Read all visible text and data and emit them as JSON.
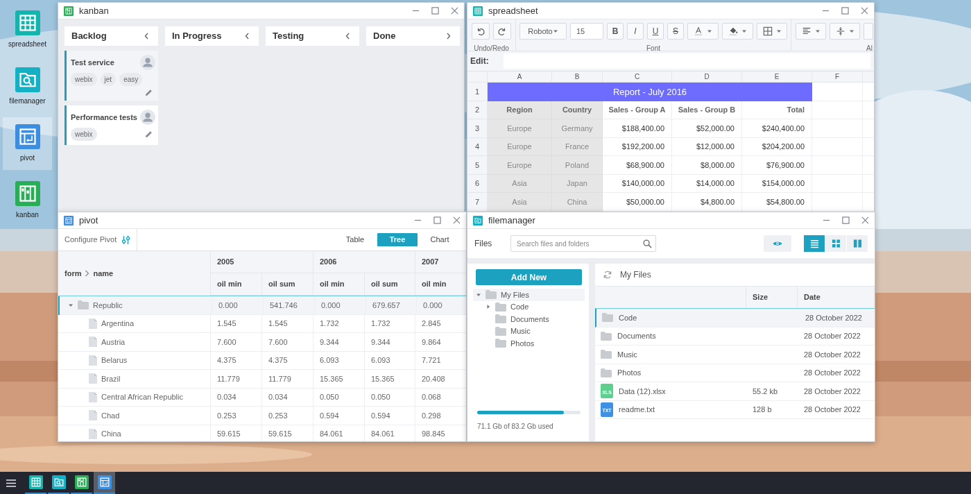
{
  "desktop_icons": [
    {
      "kind": "spreadsheet",
      "label": "spreadsheet",
      "selected": false
    },
    {
      "kind": "filemanager",
      "label": "filemanager",
      "selected": false
    },
    {
      "kind": "pivot",
      "label": "pivot",
      "selected": true
    },
    {
      "kind": "kanban",
      "label": "kanban",
      "selected": false
    }
  ],
  "kanban": {
    "title": "kanban",
    "columns": [
      {
        "title": "Backlog",
        "points_right": false,
        "cards": [
          {
            "title": "Test service",
            "tags": [
              "webix",
              "jet",
              "easy"
            ],
            "selected": true
          },
          {
            "title": "Performance tests",
            "tags": [
              "webix"
            ],
            "selected": false
          }
        ]
      },
      {
        "title": "In Progress",
        "points_right": false
      },
      {
        "title": "Testing",
        "points_right": false
      },
      {
        "title": "Done",
        "points_right": true
      }
    ]
  },
  "spreadsheet": {
    "title": "spreadsheet",
    "toolbar": {
      "font": "Roboto",
      "size": "15",
      "style_buttons": [
        "B",
        "I",
        "U",
        "S"
      ],
      "groups": [
        "Undo/Redo",
        "Font",
        "Al"
      ]
    },
    "edit_label": "Edit:",
    "columns": [
      "A",
      "B",
      "C",
      "D",
      "E",
      "F"
    ],
    "row_numbers": [
      "1",
      "2",
      "3",
      "4",
      "5",
      "6",
      "7"
    ],
    "title_cell": "Report - July 2016",
    "header": [
      "Region",
      "Country",
      "Sales - Group A",
      "Sales - Group B",
      "Total"
    ],
    "rows": [
      [
        "Europe",
        "Germany",
        "$188,400.00",
        "$52,000.00",
        "$240,400.00"
      ],
      [
        "Europe",
        "France",
        "$192,200.00",
        "$12,000.00",
        "$204,200.00"
      ],
      [
        "Europe",
        "Poland",
        "$68,900.00",
        "$8,000.00",
        "$76,900.00"
      ],
      [
        "Asia",
        "Japan",
        "$140,000.00",
        "$14,000.00",
        "$154,000.00"
      ],
      [
        "Asia",
        "China",
        "$50,000.00",
        "$4,800.00",
        "$54,800.00"
      ]
    ]
  },
  "pivot": {
    "title": "pivot",
    "configure": "Configure Pivot",
    "modes": [
      {
        "label": "Table",
        "selected": false
      },
      {
        "label": "Tree",
        "selected": true
      },
      {
        "label": "Chart",
        "selected": false
      }
    ],
    "row_header": [
      "form",
      "name"
    ],
    "years": [
      "2005",
      "2006",
      "2007"
    ],
    "measures": [
      "oil min",
      "oil sum",
      "oil min",
      "oil sum",
      "oil min"
    ],
    "rows": [
      {
        "name": "Republic",
        "expanded": true,
        "selected": true,
        "values": [
          "0.000",
          "541.746",
          "0.000",
          "679.657",
          "0.000"
        ],
        "children": [
          {
            "name": "Argentina",
            "selected": false,
            "values": [
              "1.545",
              "1.545",
              "1.732",
              "1.732",
              "2.845"
            ]
          },
          {
            "name": "Austria",
            "selected": false,
            "values": [
              "7.600",
              "7.600",
              "9.344",
              "9.344",
              "9.864"
            ]
          },
          {
            "name": "Belarus",
            "selected": false,
            "values": [
              "4.375",
              "4.375",
              "6.093",
              "6.093",
              "7.721"
            ]
          },
          {
            "name": "Brazil",
            "selected": false,
            "values": [
              "11.779",
              "11.779",
              "15.365",
              "15.365",
              "20.408"
            ]
          },
          {
            "name": "Central African Republic",
            "selected": false,
            "values": [
              "0.034",
              "0.034",
              "0.050",
              "0.050",
              "0.068"
            ]
          },
          {
            "name": "Chad",
            "selected": false,
            "values": [
              "0.253",
              "0.253",
              "0.594",
              "0.594",
              "0.298"
            ]
          },
          {
            "name": "China",
            "selected": false,
            "values": [
              "59.615",
              "59.615",
              "84.061",
              "84.061",
              "98.845"
            ]
          }
        ]
      }
    ]
  },
  "filemanager": {
    "title": "filemanager",
    "label": "Files",
    "search": {
      "placeholder": "Search files and folders"
    },
    "views": [
      {
        "kind": "list",
        "selected": true
      },
      {
        "kind": "grid",
        "selected": false
      },
      {
        "kind": "columns",
        "selected": false
      }
    ],
    "add_button": "Add New",
    "tree": [
      {
        "name": "My Files",
        "expanded": true,
        "selected": true,
        "children": [
          {
            "name": "Code",
            "has_children": true,
            "selected": false
          },
          {
            "name": "Documents",
            "has_children": false,
            "selected": false
          },
          {
            "name": "Music",
            "has_children": false,
            "selected": false
          },
          {
            "name": "Photos",
            "has_children": false,
            "selected": false
          }
        ]
      }
    ],
    "storage": {
      "level": 0.84,
      "text": "71.1 Gb of 83.2 Gb used"
    },
    "path": "My Files",
    "columns": [
      "Size",
      "Date"
    ],
    "files": [
      {
        "kind": "folder",
        "name": "Code",
        "date": "28 October 2022",
        "selected": true
      },
      {
        "kind": "folder",
        "name": "Documents",
        "date": "28 October 2022",
        "selected": false
      },
      {
        "kind": "folder",
        "name": "Music",
        "date": "28 October 2022",
        "selected": false
      },
      {
        "kind": "folder",
        "name": "Photos",
        "date": "28 October 2022",
        "selected": false
      },
      {
        "kind": "xls",
        "badge": "XLS",
        "name": "Data (12).xlsx",
        "size": "55.2 kb",
        "date": "28 October 2022",
        "selected": false
      },
      {
        "kind": "txt",
        "badge": "TXT",
        "name": "readme.txt",
        "size": "128 b",
        "date": "28 October 2022",
        "selected": false
      }
    ]
  },
  "taskbar": {
    "apps": [
      {
        "kind": "spreadsheet",
        "selected": false
      },
      {
        "kind": "filemanager",
        "selected": false
      },
      {
        "kind": "kanban",
        "selected": false
      },
      {
        "kind": "pivot",
        "selected": true
      }
    ]
  }
}
